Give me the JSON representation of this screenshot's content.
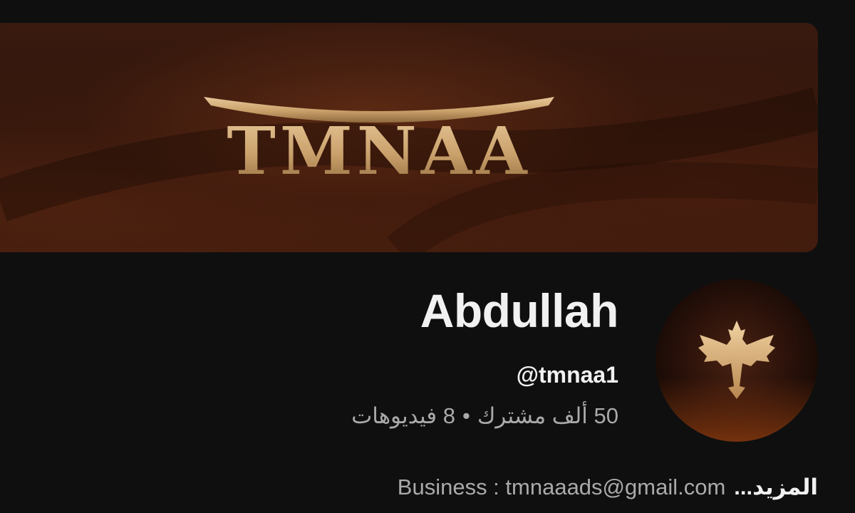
{
  "banner": {
    "logo_text": "TMNAA"
  },
  "channel": {
    "name": "Abdullah",
    "handle": "@tmnaa1",
    "subscribers": "50 ألف مشترك",
    "separator": "•",
    "videos": "8 فيديوهات"
  },
  "description": {
    "more_label": "المزيد...",
    "text": "Business : tmnaaads@gmail.com"
  },
  "colors": {
    "background": "#0f0f0f",
    "primary_text": "#f1f1f1",
    "secondary_text": "#aaaaaa",
    "banner_brown": "#3a1a0f",
    "logo_gold": "#c9a06a"
  },
  "icons": {
    "avatar_emblem": "dragon-emblem-icon"
  }
}
